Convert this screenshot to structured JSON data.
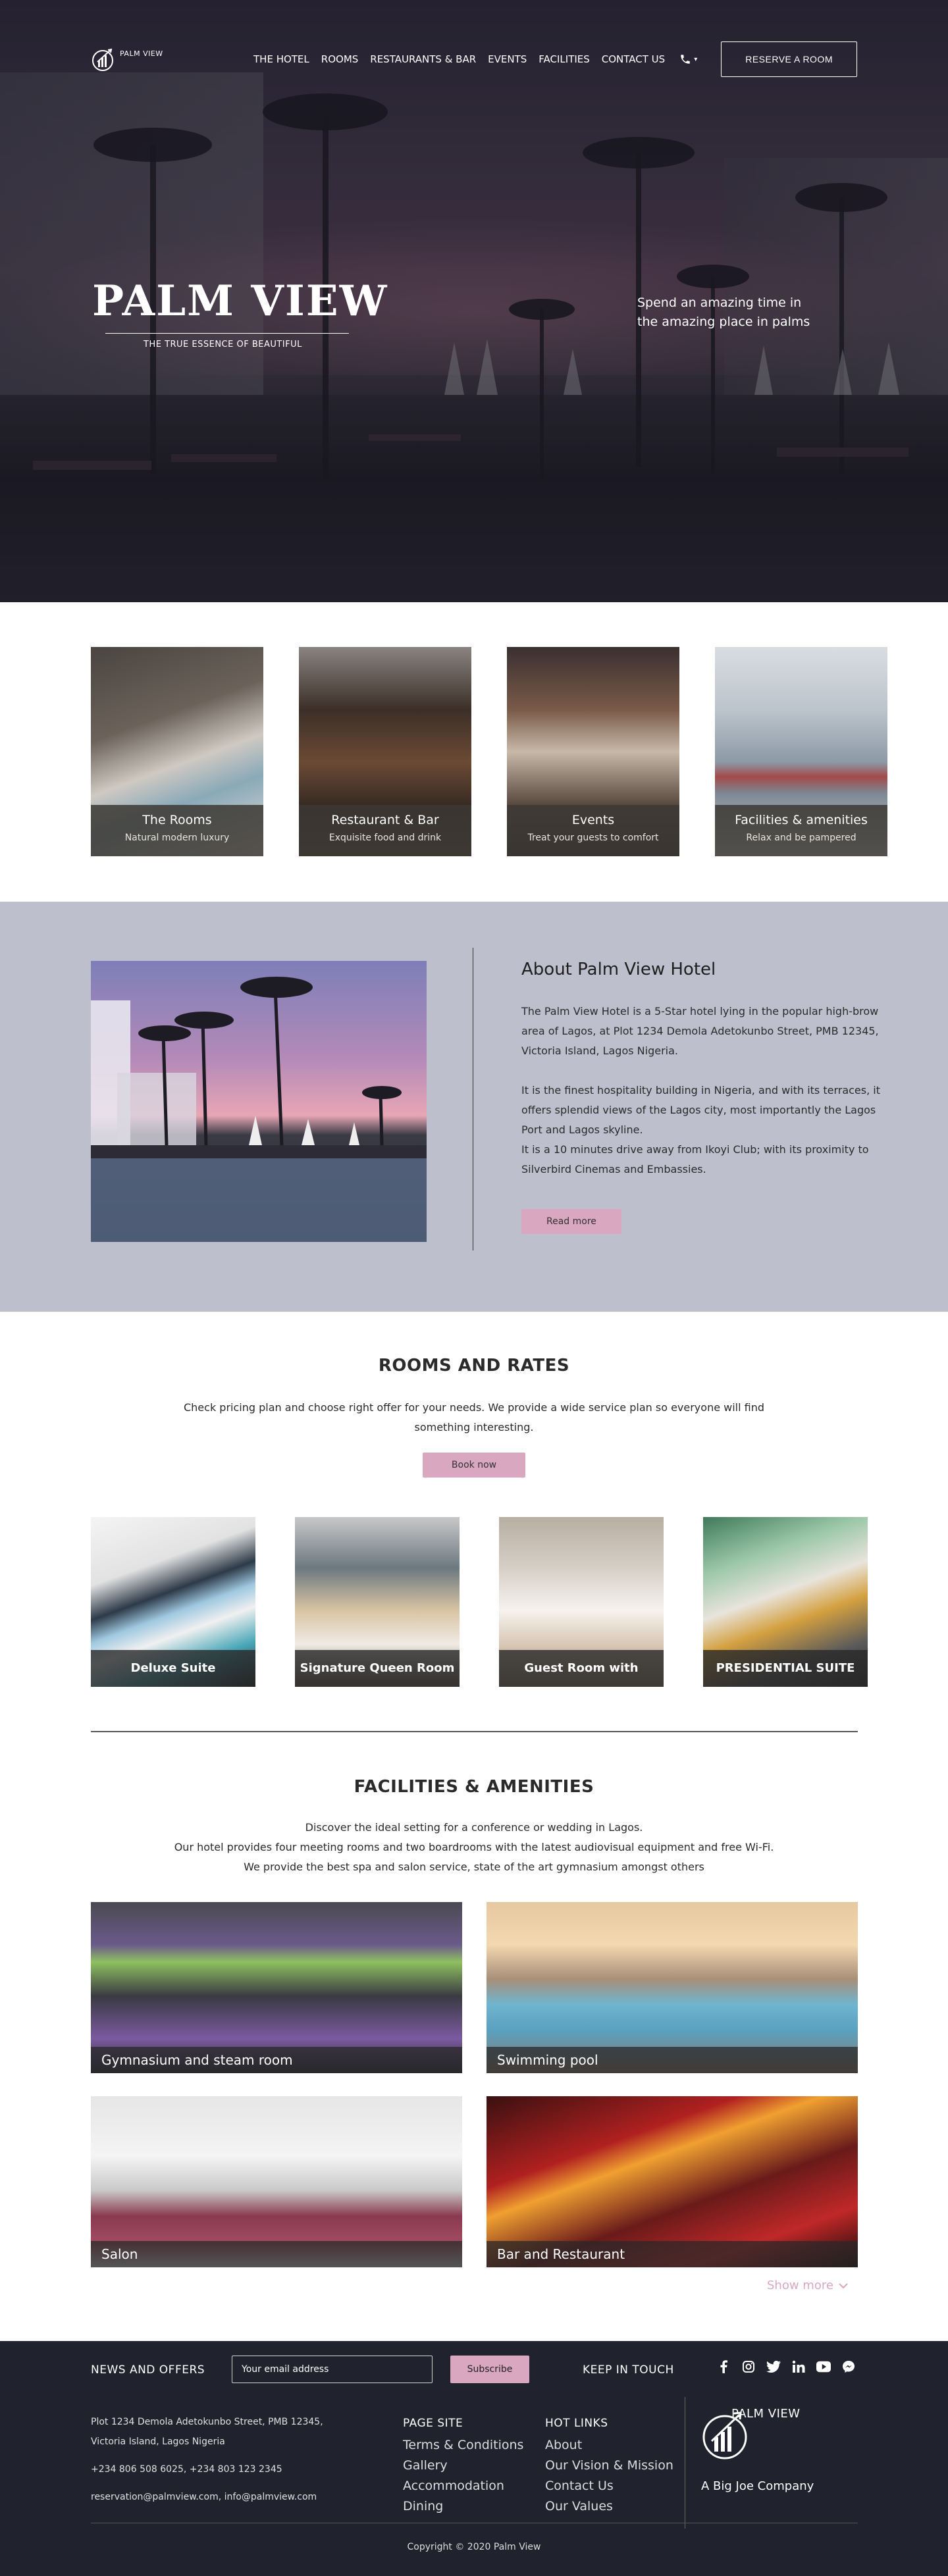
{
  "brand": {
    "name": "PALM VIEW"
  },
  "nav": {
    "items": [
      "THE HOTEL",
      "ROOMS",
      "RESTAURANTS & BAR",
      "EVENTS",
      "FACILITIES",
      "CONTACT US"
    ],
    "phone_icon": "phone-icon",
    "phone_dropdown": "▾",
    "reserve_label": "RESERVE A ROOM"
  },
  "hero": {
    "title": "PALM VIEW",
    "tagline": "THE TRUE ESSENCE OF BEAUTIFUL",
    "right_text": "Spend an amazing time in the amazing place in palms"
  },
  "categories": [
    {
      "title": "The Rooms",
      "subtitle": "Natural modern luxury"
    },
    {
      "title": "Restaurant & Bar",
      "subtitle": "Exquisite food and drink"
    },
    {
      "title": "Events",
      "subtitle": "Treat your guests to comfort"
    },
    {
      "title": "Facilities & amenities",
      "subtitle": "Relax and be pampered"
    }
  ],
  "about": {
    "title": "About Palm View Hotel",
    "p1": "The Palm View Hotel is a 5-Star hotel lying in the popular high-brow area of Lagos, at Plot 1234 Demola Adetokunbo Street, PMB 12345, Victoria Island, Lagos Nigeria.",
    "p2": "It is the finest hospitality building in Nigeria, and with its terraces, it offers splendid views of the Lagos city, most importantly the Lagos Port and Lagos skyline.",
    "p3": "It is a 10 minutes drive away from Ikoyi Club; with its proximity to Silverbird Cinemas and Embassies.",
    "button": "Read more"
  },
  "rooms": {
    "title": "ROOMS AND RATES",
    "description": "Check pricing plan and choose right offer for your needs. We provide a wide service plan so everyone will find something interesting.",
    "button": "Book now",
    "items": [
      "Deluxe Suite",
      "Signature Queen Room",
      "Guest Room with Terrace",
      "PRESIDENTIAL SUITE"
    ]
  },
  "facilities": {
    "title": "FACILITIES & AMENITIES",
    "line1": "Discover the ideal setting for a conference or wedding in Lagos.",
    "line2": "Our hotel provides four meeting rooms and two boardrooms with the latest audiovisual equipment and free Wi-Fi.",
    "line3": "We provide the best spa and salon service, state of the art gymnasium amongst others",
    "items": [
      "Gymnasium and steam room",
      "Swimming pool",
      "Salon",
      "Bar and Restaurant"
    ],
    "show_more": "Show more"
  },
  "footer": {
    "news_label": "NEWS AND OFFERS",
    "email_placeholder": "Your email address",
    "subscribe": "Subscribe",
    "keep_in_touch": "KEEP IN TOUCH",
    "social_icons": [
      "facebook-icon",
      "instagram-icon",
      "twitter-icon",
      "linkedin-icon",
      "youtube-icon",
      "messenger-icon"
    ],
    "address1": "Plot 1234 Demola Adetokunbo Street, PMB 12345,",
    "address2": "Victoria Island, Lagos Nigeria",
    "phones": "+234 806 508 6025, +234 803 123 2345",
    "emails": "reservation@palmview.com, info@palmview.com",
    "page_site": {
      "heading": "PAGE SITE",
      "links": [
        "Terms & Conditions",
        "Gallery",
        "Accommodation",
        "Dining"
      ]
    },
    "hot_links": {
      "heading": "HOT LINKS",
      "links": [
        "About",
        "Our Vision & Mission",
        "Contact Us",
        "Our Values"
      ]
    },
    "logo_name": "PALM VIEW",
    "company": "A Big Joe Company",
    "copyright": "Copyright © 2020 Palm View"
  }
}
